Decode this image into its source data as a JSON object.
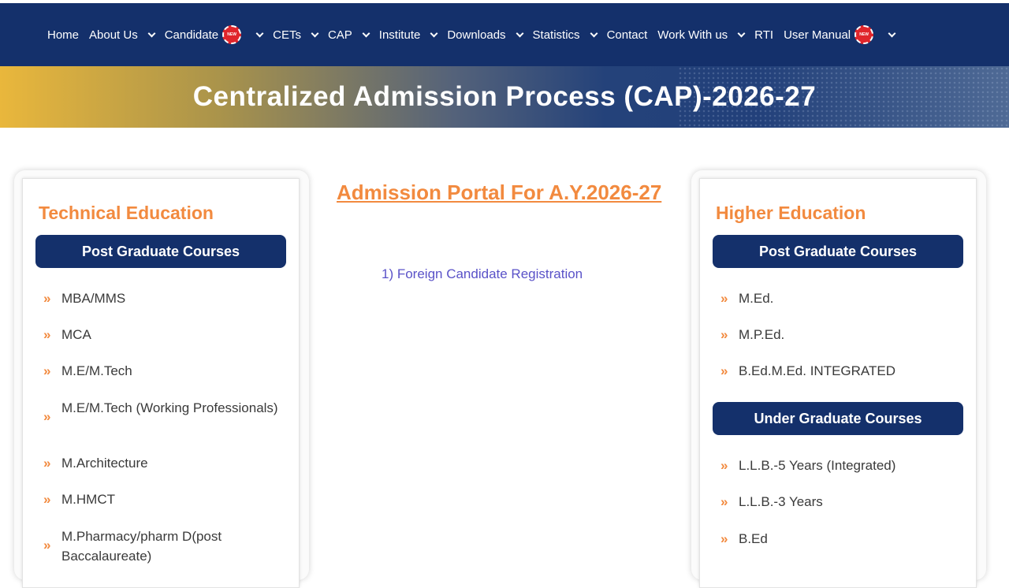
{
  "nav": {
    "items": [
      {
        "label": "Home"
      },
      {
        "label": "About Us"
      },
      {
        "label": "Candidate",
        "badge": "NEW"
      },
      {
        "label": "CETs"
      },
      {
        "label": "CAP"
      },
      {
        "label": "Institute"
      },
      {
        "label": "Downloads"
      },
      {
        "label": "Statistics"
      },
      {
        "label": "Contact"
      },
      {
        "label": "Work With us"
      },
      {
        "label": "RTI"
      },
      {
        "label": "User Manual",
        "badge": "NEW"
      }
    ],
    "background_color": "#14306b",
    "badge_color": "#e0252b"
  },
  "banner": {
    "title": "Centralized Admission Process (CAP)-2026-27"
  },
  "technical": {
    "title": "Technical Education",
    "pg_heading": "Post Graduate Courses",
    "courses": [
      "MBA/MMS",
      "MCA",
      "M.E/M.Tech",
      "M.E/M.Tech (Working Professionals)",
      "M.Architecture",
      "M.HMCT",
      "M.Pharmacy/pharm D(post Baccalaureate)"
    ]
  },
  "portal": {
    "title": "Admission Portal For A.Y.2026-27",
    "link": "1) Foreign Candidate Registration"
  },
  "higher": {
    "title": "Higher Education",
    "pg_heading": "Post Graduate Courses",
    "pg_courses": [
      "M.Ed.",
      "M.P.Ed.",
      "B.Ed.M.Ed. INTEGRATED"
    ],
    "ug_heading": "Under Graduate Courses",
    "ug_courses": [
      "L.L.B.-5 Years (Integrated)",
      "L.L.B.-3 Years",
      "B.Ed"
    ]
  },
  "icons": {
    "course_bullet": "double-chevron-right-icon",
    "dropdown": "chevron-down-icon",
    "new_badge": "new-badge-icon"
  },
  "colors": {
    "accent": "#f28a3f",
    "navy": "#14306b",
    "link": "#5a52c8"
  }
}
